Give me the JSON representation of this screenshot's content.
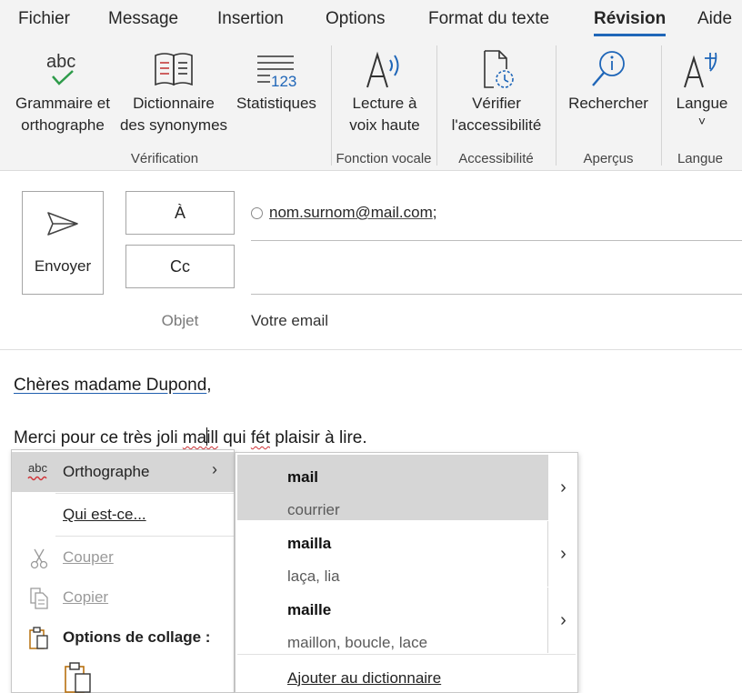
{
  "tabs": [
    "Fichier",
    "Message",
    "Insertion",
    "Options",
    "Format du texte",
    "Révision",
    "Aide"
  ],
  "active_tab": "Révision",
  "ribbon": {
    "buttons": [
      {
        "line1": "Grammaire et",
        "line2": "orthographe",
        "icon": "spelling-check-icon",
        "icon_text": "abc"
      },
      {
        "line1": "Dictionnaire",
        "line2": "des synonymes",
        "icon": "thesaurus-book-icon"
      },
      {
        "line1": "Statistiques",
        "line2": "",
        "icon": "word-count-icon",
        "icon_text": "123"
      },
      {
        "line1": "Lecture à",
        "line2": "voix haute",
        "icon": "read-aloud-icon"
      },
      {
        "line1": "Vérifier",
        "line2": "l'accessibilité",
        "icon": "check-accessibility-icon"
      },
      {
        "line1": "Rechercher",
        "line2": "",
        "icon": "search-info-icon"
      },
      {
        "line1": "Langue",
        "line2": "˅",
        "icon": "language-icon"
      }
    ],
    "groups": [
      "Vérification",
      "Fonction vocale",
      "Accessibilité",
      "Aperçus",
      "Langue"
    ]
  },
  "compose": {
    "send_label": "Envoyer",
    "to_label": "À",
    "cc_label": "Cc",
    "to_value": "nom.surnom@mail.com",
    "to_separator": ";",
    "subject_label": "Objet",
    "subject_value": "Votre email"
  },
  "body": {
    "greeting": "Chères madame Dupond",
    "greeting_punct": ",",
    "line2_before": "Merci pour ce très joli ",
    "misspelled_1_a": "ma",
    "misspelled_1_b": "ill",
    "line2_mid": " qui ",
    "misspelled_2": "fét",
    "line2_after": " plaisir à lire."
  },
  "context_menu": {
    "spelling": "Orthographe",
    "spelling_icon_text": "abc",
    "who_is": "Qui est-ce...",
    "cut": "Couper",
    "copy": "Copier",
    "paste_options": "Options de collage :"
  },
  "spelling_submenu": {
    "suggestions": [
      {
        "word": "mail",
        "synonyms": "courrier"
      },
      {
        "word": "mailla",
        "synonyms": "laça, lia"
      },
      {
        "word": "maille",
        "synonyms": "maillon, boucle, lace"
      }
    ],
    "add_to_dictionary": "Ajouter au dictionnaire"
  },
  "colors": {
    "accent": "#1f66b8",
    "ribbon_bg": "#f3f3f3",
    "highlight": "#d6d6d6",
    "spell_error": "#d13438"
  }
}
